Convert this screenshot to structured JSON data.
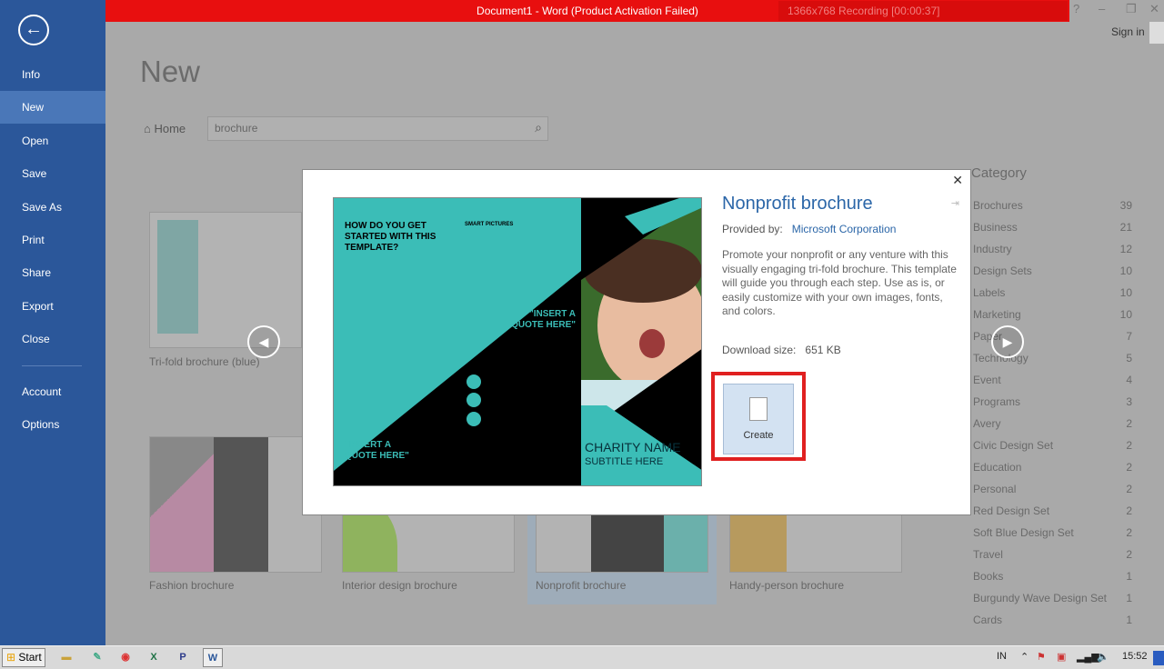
{
  "window": {
    "title": "Document1 - Word (Product Activation Failed)",
    "sign_in": "Sign in",
    "recorder": "1366x768  Recording [00:00:37]",
    "help": "?",
    "minimize": "–",
    "restore": "❐",
    "close": "✕"
  },
  "sidebar": {
    "back": "←",
    "items": [
      {
        "label": "Info"
      },
      {
        "label": "New"
      },
      {
        "label": "Open"
      },
      {
        "label": "Save"
      },
      {
        "label": "Save As"
      },
      {
        "label": "Print"
      },
      {
        "label": "Share"
      },
      {
        "label": "Export"
      },
      {
        "label": "Close"
      },
      {
        "label": "Account"
      },
      {
        "label": "Options"
      }
    ]
  },
  "main": {
    "title": "New",
    "home": "Home",
    "search_value": "brochure",
    "templates": [
      {
        "label": "Tri-fold brochure (blue)"
      },
      {
        "label": "Fashion brochure"
      },
      {
        "label": "Interior design brochure"
      },
      {
        "label": "Nonprofit brochure"
      },
      {
        "label": "Handy-person brochure"
      }
    ]
  },
  "category": {
    "title": "Category",
    "items": [
      {
        "name": "Brochures",
        "count": "39"
      },
      {
        "name": "Business",
        "count": "21"
      },
      {
        "name": "Industry",
        "count": "12"
      },
      {
        "name": "Design Sets",
        "count": "10"
      },
      {
        "name": "Labels",
        "count": "10"
      },
      {
        "name": "Marketing",
        "count": "10"
      },
      {
        "name": "Paper",
        "count": "7"
      },
      {
        "name": "Technology",
        "count": "5"
      },
      {
        "name": "Event",
        "count": "4"
      },
      {
        "name": "Programs",
        "count": "3"
      },
      {
        "name": "Avery",
        "count": "2"
      },
      {
        "name": "Civic Design Set",
        "count": "2"
      },
      {
        "name": "Education",
        "count": "2"
      },
      {
        "name": "Personal",
        "count": "2"
      },
      {
        "name": "Red Design Set",
        "count": "2"
      },
      {
        "name": "Soft Blue Design Set",
        "count": "2"
      },
      {
        "name": "Travel",
        "count": "2"
      },
      {
        "name": "Books",
        "count": "1"
      },
      {
        "name": "Burgundy Wave Design Set",
        "count": "1"
      },
      {
        "name": "Cards",
        "count": "1"
      }
    ]
  },
  "dialog": {
    "title": "Nonprofit brochure",
    "provided_by_label": "Provided by:",
    "provider": "Microsoft Corporation",
    "description": "Promote your nonprofit or any venture with this visually engaging tri-fold brochure. This template will guide you through each step. Use as is, or easily customize with your own images, fonts, and colors.",
    "download_size_label": "Download size:",
    "download_size": "651 KB",
    "create_label": "Create",
    "close": "✕",
    "preview": {
      "heading": "HOW DO YOU GET STARTED WITH THIS TEMPLATE?",
      "smart": "SMART PICTURES",
      "quote1": "\"INSERT A QUOTE HERE\"",
      "quote2": "\"INSERT A QUOTE HERE\"",
      "charity": "CHARITY NAME",
      "subtitle": "SUBTITLE HERE"
    }
  },
  "taskbar": {
    "start": "Start",
    "lang": "IN",
    "time": "15:52"
  },
  "colors": {
    "word_blue": "#2b579a",
    "teal": "#3bbdb7",
    "create_border": "#e02020"
  }
}
